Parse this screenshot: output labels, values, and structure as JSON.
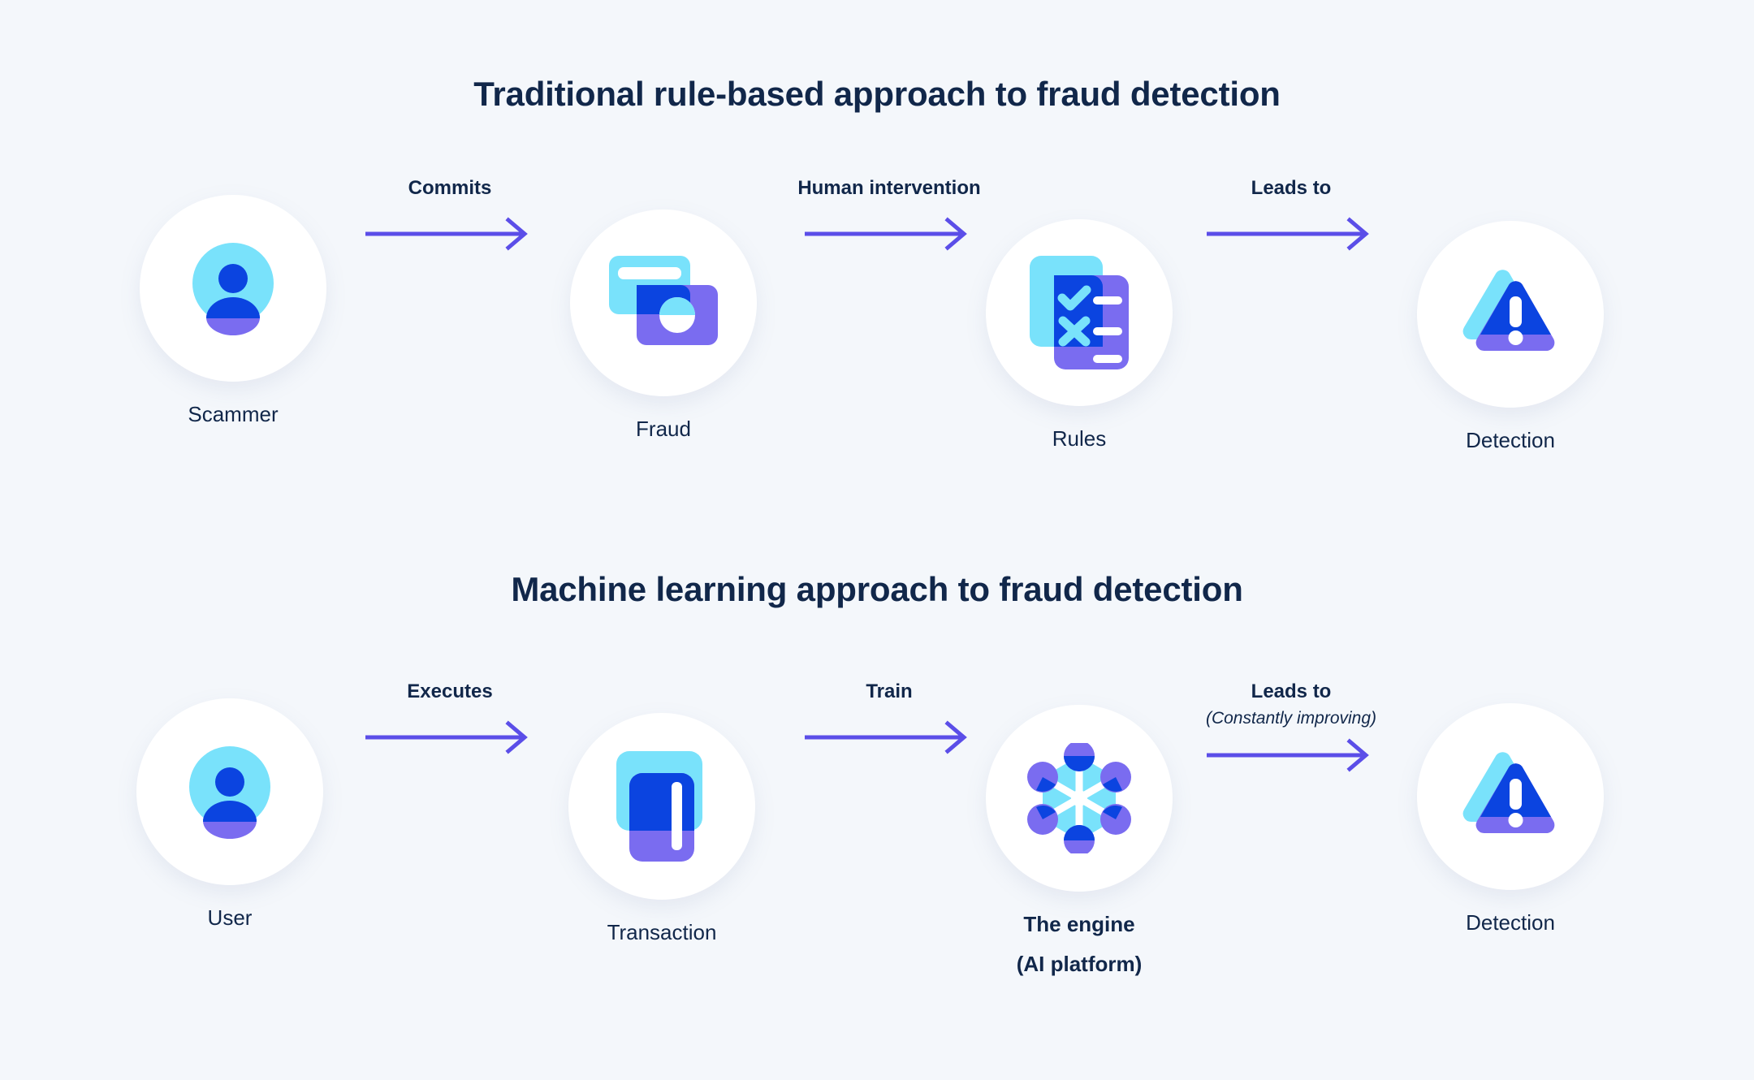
{
  "theme": {
    "background": "#f4f7fb",
    "circle": "#ffffff",
    "text_dark": "#11274a",
    "arrow": "#5b4ee8",
    "cyan": "#79e2fb",
    "blue": "#0b44e0",
    "purple": "#7a6cf0",
    "white": "#ffffff"
  },
  "sections": [
    {
      "id": "rule-based",
      "title": "Traditional rule-based approach to fraud detection",
      "nodes": [
        {
          "icon": "person-icon",
          "label": "Scammer",
          "sub": ""
        },
        {
          "icon": "credit-cards-icon",
          "label": "Fraud",
          "sub": ""
        },
        {
          "icon": "checklist-icon",
          "label": "Rules",
          "sub": ""
        },
        {
          "icon": "warning-alert-icon",
          "label": "Detection",
          "sub": ""
        }
      ],
      "connectors": [
        {
          "label": "Commits",
          "sub": ""
        },
        {
          "label": "Human intervention",
          "sub": ""
        },
        {
          "label": "Leads to",
          "sub": ""
        }
      ]
    },
    {
      "id": "machine-learning",
      "title": "Machine learning approach to fraud detection",
      "nodes": [
        {
          "icon": "person-icon",
          "label": "User",
          "sub": ""
        },
        {
          "icon": "transaction-icon",
          "label": "Transaction",
          "sub": ""
        },
        {
          "icon": "network-node-icon",
          "label": "The engine",
          "sub": "(AI platform)"
        },
        {
          "icon": "warning-alert-icon",
          "label": "Detection",
          "sub": ""
        }
      ],
      "connectors": [
        {
          "label": "Executes",
          "sub": ""
        },
        {
          "label": "Train",
          "sub": ""
        },
        {
          "label": "Leads to",
          "sub": "(Constantly improving)"
        }
      ]
    }
  ]
}
